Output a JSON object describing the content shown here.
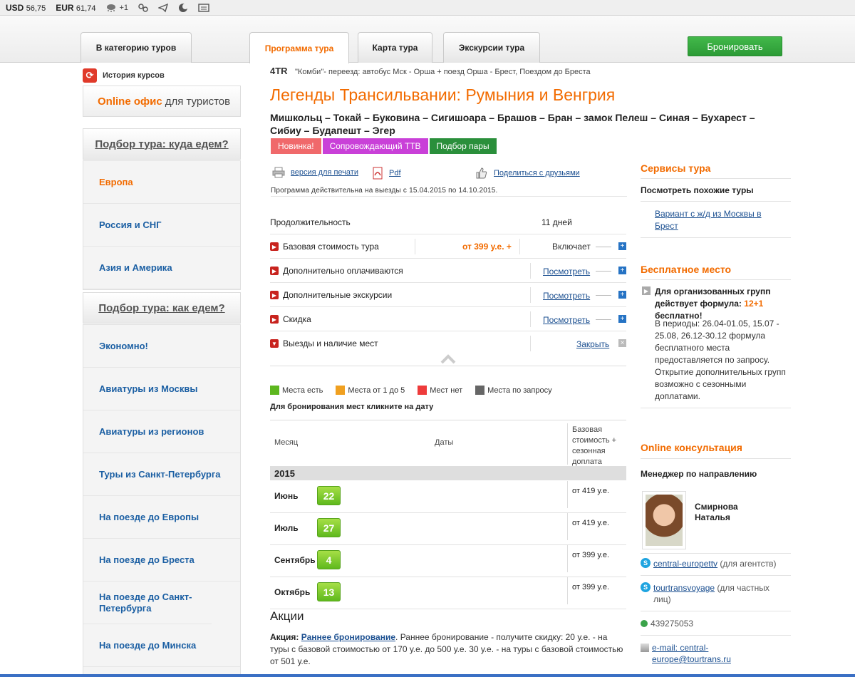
{
  "topbar": {
    "usd_label": "USD",
    "usd_value": "56,75",
    "eur_label": "EUR",
    "eur_value": "61,74",
    "weather": "+1",
    "icons": [
      "weather-icon",
      "zodiac-icon",
      "telegram-icon",
      "moon-icon",
      "news-icon"
    ]
  },
  "tabs": [
    {
      "label": "В категорию туров"
    },
    {
      "label": "Программа тура"
    },
    {
      "label": "Карта тура"
    },
    {
      "label": "Экскурсии тура"
    }
  ],
  "book_button": "Бронировать",
  "left": {
    "history": "История курсов",
    "office_1": "Online офис",
    "office_2": "для туристов",
    "box1_title": "Подбор тура: куда едем?",
    "box1_items": [
      "Европа",
      "Россия и СНГ",
      "Азия и Америка"
    ],
    "box2_title": "Подбор тура: как едем?",
    "box2_items": [
      "Экономно!",
      "Авиатуры из Москвы",
      "Авиатуры из регионов",
      "Туры из Санкт-Петербурга",
      "На поезде до Европы",
      "На поезде до Бреста",
      "На поезде до Санкт-Петербурга",
      "На поезде до Минска"
    ]
  },
  "tour": {
    "code": "4TR",
    "route": "\"Комби\"- переезд: автобус Мск - Орша + поезд Орша - Брест, Поездом до Бреста",
    "title": "Легенды Трансильвании: Румыния и Венгрия",
    "cities": "Мишкольц – Токай – Буковина – Сигишоара – Брашов – Бран – замок Пелеш – Синая – Бухарест – Сибиу – Будапешт – Эгер",
    "badges": [
      "Новинка!",
      "Сопровождающий ТТВ",
      "Подбор пары"
    ],
    "print": "версия для печати",
    "pdf": "Pdf",
    "share": "Поделиться с друзьями",
    "validity": "Программа действительна на выезды с 15.04.2015 по 14.10.2015."
  },
  "details": {
    "duration_label": "Продолжительность",
    "duration_value": "11 дней",
    "base_label": "Базовая стоимость тура",
    "base_price": "от 399 у.е. +",
    "base_link": "Включает",
    "extra_paid": "Дополнительно оплачиваются",
    "extra_exc": "Дополнительные экскурсии",
    "discount": "Скидка",
    "departures": "Выезды и наличие мест",
    "view": "Посмотреть",
    "close": "Закрыть"
  },
  "legend": [
    {
      "label": "Места есть",
      "color": "#5db71f"
    },
    {
      "label": "Места от 1 до 5",
      "color": "#f0a020"
    },
    {
      "label": "Мест нет",
      "color": "#ee3b3b"
    },
    {
      "label": "Места по запросу",
      "color": "#666666"
    }
  ],
  "hint": "Для бронирования мест кликните на дату",
  "table": {
    "col_month": "Месяц",
    "col_dates": "Даты",
    "col_price": "Базовая стоимость + сезонная доплата",
    "year": "2015",
    "rows": [
      {
        "month": "Июнь",
        "date": "22",
        "price": "от 419 у.е."
      },
      {
        "month": "Июль",
        "date": "27",
        "price": "от 419 у.е."
      },
      {
        "month": "Сентябрь",
        "date": "4",
        "price": "от 399 у.е."
      },
      {
        "month": "Октябрь",
        "date": "13",
        "price": "от 399 у.е."
      }
    ]
  },
  "promo": {
    "title": "Акции",
    "label": "Акция:",
    "link": "Раннее бронирование",
    "text": ". Раннее бронирование - получите скидку: 20 у.е. - на туры с базовой стоимостью от 170 у.е. до 500 у.е. 30 у.е. - на туры с базовой стоимостью от 501 у.е."
  },
  "right": {
    "services_title": "Сервисы тура",
    "similar": "Посмотреть похожие туры",
    "variant": "Вариант с ж/д из Москвы в Брест",
    "free_title": "Бесплатное место",
    "free_bold_1": "Для организованных групп действует формула:",
    "free_formula": "12+1",
    "free_bold_2": "бесплатно!",
    "free_text": "В периоды: 26.04-01.05, 15.07 - 25.08, 26.12-30.12 формула бесплатного места предоставляется по запросу. Открытие дополнительных групп возможно с сезонными доплатами.",
    "consult_title": "Online консультация",
    "manager_label": "Менеджер по направлению",
    "manager_name": "Смирнова Наталья",
    "skype1": "central-europettv",
    "skype1_note": "(для агентств)",
    "skype2": "tourtransvoyage",
    "skype2_note": "(для частных лиц)",
    "phone": "439275053",
    "email": "e-mail: central-europe@tourtrans.ru"
  }
}
